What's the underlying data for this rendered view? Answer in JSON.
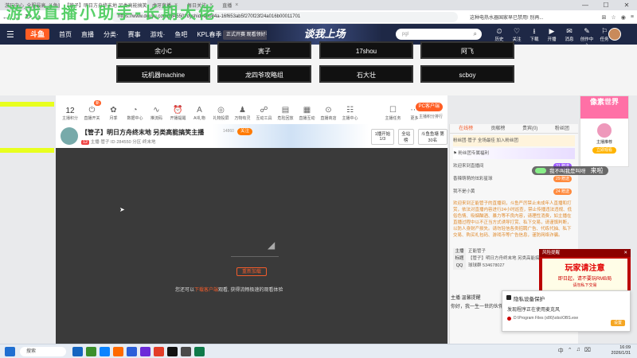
{
  "browser": {
    "tabs": [
      {
        "label": "游玩中心_全服最高_斗鱼直播"
      },
      {
        "label": "【管子】明日方舟终末地 另类高能搞笑主播_斗鱼直播",
        "active": true
      },
      {
        "label": "虎牙直播"
      },
      {
        "label": "每日关注"
      },
      {
        "label": "直播"
      }
    ],
    "address": "https://www.douyu.com/284550?dyshid=a9b84a-16f653ab5f270f23f24a016b00011701",
    "address_right": "这种电热水器国家早已禁用! 别再...",
    "toolbar_right": [
      "应用",
      "书签",
      "账户",
      "菜单"
    ]
  },
  "overlay": {
    "text": "游戏直播小助手-长期大佬"
  },
  "site": {
    "logo": "斗鱼",
    "nav": [
      "首页",
      "直播",
      "分类·",
      "赛事",
      "游戏·",
      "鱼吧",
      "KPL春季"
    ],
    "nav_badge": "正式开赛 观看领好礼",
    "banner": "谈我上场",
    "search_placeholder": "pgl",
    "header_icons": [
      {
        "label": "历史",
        "glyph": "⏲"
      },
      {
        "label": "关注",
        "glyph": "♡"
      },
      {
        "label": "下载",
        "glyph": "⭳"
      },
      {
        "label": "开播",
        "glyph": "▶"
      },
      {
        "label": "消息",
        "glyph": "✉"
      },
      {
        "label": "创作中心",
        "glyph": "✎"
      },
      {
        "label": "任务",
        "glyph": "⚐"
      }
    ]
  },
  "recommend": {
    "tags": [
      "余小C",
      "寅子",
      "17shou",
      "阿飞",
      "玩机器machine",
      "龙四爷攻略组",
      "石大壮",
      "scboy"
    ]
  },
  "room_tools": {
    "rank_count": "12",
    "rank_label": "主播积分",
    "new_badge": "新",
    "items": [
      {
        "label": "直播开关",
        "glyph": "⏻"
      },
      {
        "label": "月季",
        "glyph": "✿"
      },
      {
        "label": "数据中心",
        "glyph": "◔"
      },
      {
        "label": "推流码",
        "glyph": "∿"
      },
      {
        "label": "开播提醒",
        "glyph": "⏰"
      },
      {
        "label": "AI礼物",
        "glyph": "A"
      },
      {
        "label": "礼物投屏",
        "glyph": "◎"
      },
      {
        "label": "万物有灵",
        "glyph": "♟"
      },
      {
        "label": "互动工具",
        "glyph": "☍"
      },
      {
        "label": "危险回放",
        "glyph": "▤"
      },
      {
        "label": "直播互动",
        "glyph": "▦"
      },
      {
        "label": "直播商店",
        "glyph": "⊙"
      },
      {
        "label": "主播中心",
        "glyph": "☷"
      },
      {
        "label": "",
        "glyph": ""
      },
      {
        "label": "主播任务",
        "glyph": "☐"
      },
      {
        "label": "更多",
        "glyph": "⋯"
      }
    ],
    "pc_button": "PC客户端",
    "follow_right": "主播积分排行"
  },
  "room": {
    "title": "【管子】明日方舟终末地 另类高能搞笑主播",
    "hot": "14860",
    "follow": "关注",
    "level": "12",
    "sub": "主播·管子  ID·284550  分区·终末地",
    "right_boxes": [
      "1播开始 1/3",
      "全站榜",
      "斗鱼鱼塘 第30名"
    ]
  },
  "player": {
    "retry": "重新加载",
    "tip_pre": "您还可以",
    "tip_hl": "下载客户端",
    "tip_post": "观看, 获得流畅极速的观看体验"
  },
  "chat": {
    "tabs": [
      "在线榜",
      "贡献榜",
      "贵宾(0)",
      "粉丝团"
    ],
    "rows": [
      {
        "text": "粉丝团·管子 全场最佳 加入粉丝团",
        "style": "gold",
        "pill": ""
      },
      {
        "text": "⚑ 粉丝团专属福利",
        "style": "purple",
        "pill": ""
      },
      {
        "text": "欢迎来到直播间",
        "style": "purple",
        "pill": "31 赠送"
      },
      {
        "text": "香辣萌萌的炫彩星球",
        "style": "",
        "pill": "29 赠送"
      },
      {
        "text": "我不是小黄",
        "style": "",
        "pill": "24 赠送"
      }
    ],
    "notice": "欢迎来到正能管子的直播间，斗鱼严厉禁止未成年人直播和打赏，依法对直播内容进行24小时巡查，禁止传播违法违规、低俗色情、吸烟酗酒、暴力等不良内容，请理性消费，如主播在直播过程中以不正当方式诱导打赏、私下交易，请谨慎判断，以防人身财产损失。请勿轻信各类招聘广告、代练代抽、私下交易、购买礼包码、游戏币等广告信息，谨防网络诈骗。",
    "info": [
      {
        "k": "主播",
        "v": "正能管子"
      },
      {
        "k": "标题",
        "v": "【管子】明日方舟终末地 另类高能搞笑主播"
      },
      {
        "k": "QQ",
        "v": "球球群 534678027"
      }
    ],
    "user_line1": "主播  温馨提醒",
    "user_line2": "你好，我一生一世的伙伴"
  },
  "promo": {
    "title": "像素世界",
    "name": "主播推荐",
    "button": "立即观看"
  },
  "danmaku": {
    "text": "我不叫我是叫呀",
    "tail": "来啦"
  },
  "warning": {
    "header": "风险提醒",
    "line1": "玩家请注意",
    "line2": "即日起，请不要玩RMB局",
    "line3": "请勿私下交易"
  },
  "toast": {
    "header": "隐私设备保护",
    "body": "发现程序正在使用麦克风",
    "path": "D:\\Program Files (x86)\\obs\\OBS.exe",
    "button": "设置"
  },
  "taskbar": {
    "search": "搜索",
    "tray": [
      "中",
      "⌃",
      "♫",
      "⌧"
    ],
    "time": "16:09",
    "date": "2026/1/31",
    "icon_colors": [
      "#1565c0",
      "#3b8f2b",
      "#0a84ff",
      "#ff6a00",
      "#2b5fd9",
      "#6c2bd9",
      "#e23d28",
      "#111111",
      "#4a4a4a",
      "#0f7a4a"
    ]
  }
}
